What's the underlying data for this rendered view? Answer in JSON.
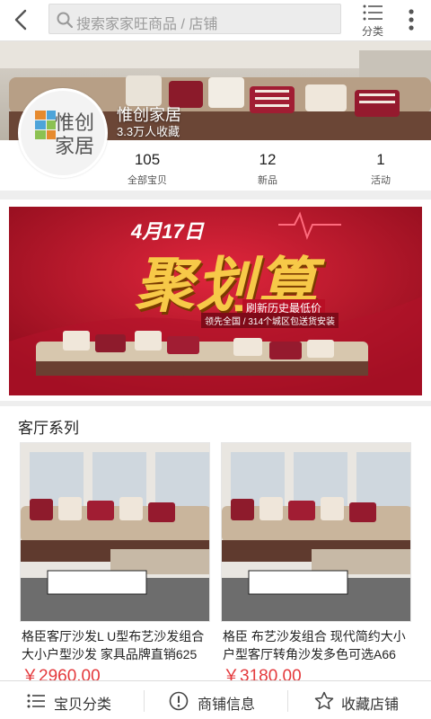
{
  "header": {
    "search_placeholder": "搜索家家旺商品 / 店铺",
    "category_label": "分类"
  },
  "shop": {
    "name": "惟创家居",
    "favorites": "3.3万人收藏",
    "logo_text_top": "惟创",
    "logo_text_bottom": "家居",
    "stats": [
      {
        "value": "105",
        "label": "全部宝贝"
      },
      {
        "value": "12",
        "label": "新品"
      },
      {
        "value": "1",
        "label": "活动"
      }
    ]
  },
  "promo": {
    "date": "4月17日",
    "headline": "聚划算",
    "tagline": "刷新历史最低价",
    "subline": "领先全国 / 314个城区包送货安装"
  },
  "section": {
    "title": "客厅系列",
    "products": [
      {
        "title": "格臣客厅沙发L U型布艺沙发组合大小户型沙发 家具品牌直销625",
        "price": "￥2960.00"
      },
      {
        "title": "格臣 布艺沙发组合 现代简约大小户型客厅转角沙发多色可选A66",
        "price": "￥3180.00"
      }
    ]
  },
  "bottom_bar": {
    "items": [
      {
        "label": "宝贝分类"
      },
      {
        "label": "商铺信息"
      },
      {
        "label": "收藏店铺"
      }
    ]
  },
  "colors": {
    "price": "#e4393c",
    "promo_red": "#c8102e",
    "promo_gold": "#f7c948"
  }
}
